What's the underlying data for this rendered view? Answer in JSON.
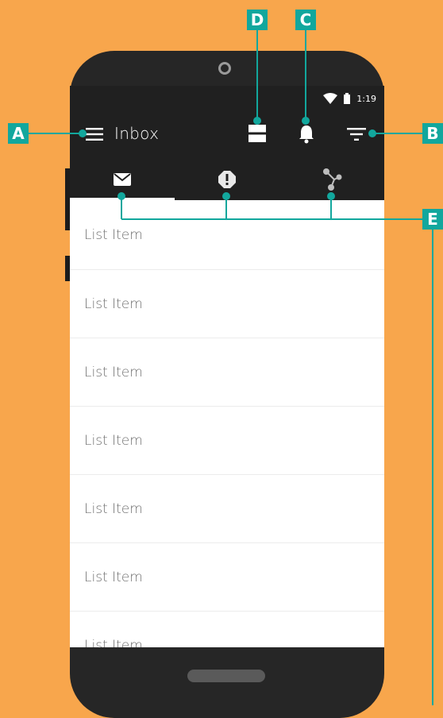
{
  "status": {
    "time": "1:19"
  },
  "appbar": {
    "title": "Inbox",
    "icons": [
      "menu-icon",
      "view-agenda-icon",
      "notifications-icon",
      "filter-icon"
    ]
  },
  "tabs": [
    {
      "icon": "mail-icon",
      "selected": true
    },
    {
      "icon": "alert-icon",
      "selected": false
    },
    {
      "icon": "share-icon",
      "selected": false
    }
  ],
  "list": {
    "items": [
      "List Item",
      "List Item",
      "List Item",
      "List Item",
      "List Item",
      "List Item",
      "List Item"
    ]
  },
  "callouts": {
    "a": "A",
    "b": "B",
    "c": "C",
    "d": "D",
    "e": "E"
  },
  "colors": {
    "background": "#F8A64C",
    "appbar": "#202020",
    "callout": "#12A79D"
  }
}
